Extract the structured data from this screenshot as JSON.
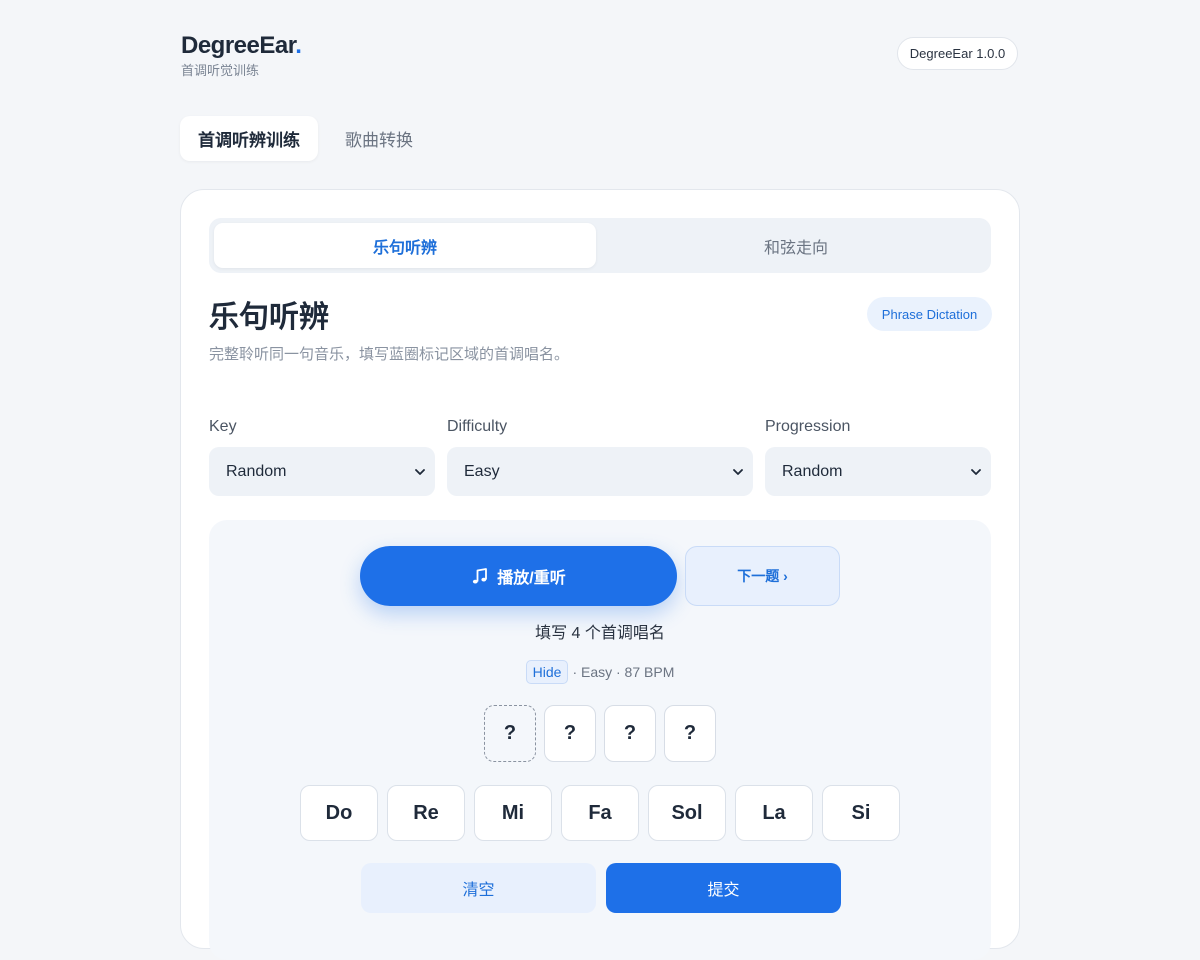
{
  "header": {
    "brand_name": "DegreeEar",
    "brand_dot": ".",
    "brand_subtitle": "首调听觉训练",
    "version": "DegreeEar 1.0.0"
  },
  "top_tabs": [
    {
      "label": "首调听辨训练",
      "active": true
    },
    {
      "label": "歌曲转换",
      "active": false
    }
  ],
  "segments": [
    {
      "label": "乐句听辨",
      "active": true
    },
    {
      "label": "和弦走向",
      "active": false
    }
  ],
  "section": {
    "title": "乐句听辨",
    "badge": "Phrase Dictation",
    "description": "完整聆听同一句音乐，填写蓝圈标记区域的首调唱名。"
  },
  "selects": {
    "key": {
      "label": "Key",
      "value": "Random"
    },
    "difficulty": {
      "label": "Difficulty",
      "value": "Easy"
    },
    "progression": {
      "label": "Progression",
      "value": "Random"
    }
  },
  "practice": {
    "play_label": "播放/重听",
    "next_label": "下一题 ›",
    "prompt": "填写 4 个首调唱名",
    "hide_label": "Hide",
    "meta_text": "· Easy · 87 BPM",
    "slots": [
      "?",
      "?",
      "?",
      "?"
    ],
    "notes": [
      "Do",
      "Re",
      "Mi",
      "Fa",
      "Sol",
      "La",
      "Si"
    ],
    "clear_label": "清空",
    "submit_label": "提交"
  },
  "icons": {
    "play": "music-note-icon",
    "select_caret": "chevron-down-icon"
  },
  "colors": {
    "accent": "#1e70e8",
    "background": "#f4f6f9",
    "card": "#ffffff"
  }
}
